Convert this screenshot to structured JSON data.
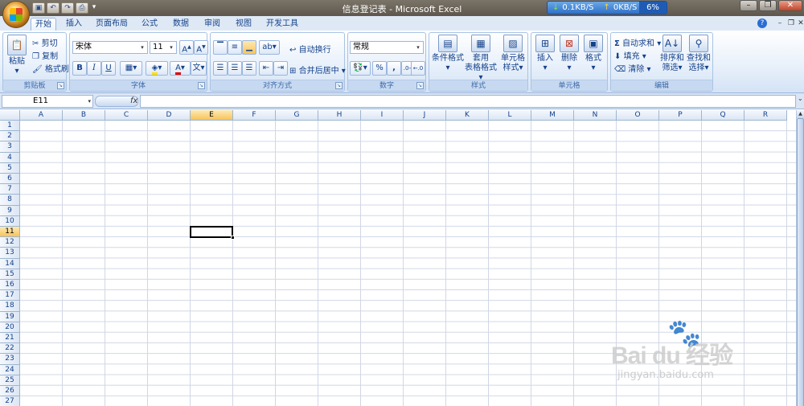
{
  "window": {
    "title": "信息登记表 - Microsoft Excel",
    "net_down": "0.1KB/S",
    "net_up": "0KB/S",
    "net_pct": "6%"
  },
  "tabs": [
    "开始",
    "插入",
    "页面布局",
    "公式",
    "数据",
    "审阅",
    "视图",
    "开发工具"
  ],
  "ribbon": {
    "clipboard": {
      "label": "剪贴板",
      "paste": "粘贴",
      "cut": "剪切",
      "copy": "复制",
      "format_painter": "格式刷"
    },
    "font": {
      "label": "字体",
      "name": "宋体",
      "size": "11",
      "bold": "B",
      "italic": "I",
      "underline": "U",
      "font_color_label": "A"
    },
    "alignment": {
      "label": "对齐方式",
      "wrap": "自动换行",
      "merge": "合并后居中"
    },
    "number": {
      "label": "数字",
      "format": "常规",
      "percent": "%",
      "comma": ","
    },
    "styles": {
      "label": "样式",
      "conditional": "条件格式",
      "table_format_1": "套用",
      "table_format_2": "表格格式",
      "cell_styles_1": "单元格",
      "cell_styles_2": "样式"
    },
    "cells": {
      "label": "单元格",
      "insert": "插入",
      "delete": "删除",
      "format": "格式"
    },
    "editing": {
      "label": "编辑",
      "autosum": "自动求和",
      "fill": "填充",
      "clear": "清除",
      "sort_1": "排序和",
      "sort_2": "筛选",
      "find_1": "查找和",
      "find_2": "选择"
    }
  },
  "formula_bar": {
    "name_box": "E11",
    "fx": "fx"
  },
  "columns": [
    "A",
    "B",
    "C",
    "D",
    "E",
    "F",
    "G",
    "H",
    "I",
    "J",
    "K",
    "L",
    "M",
    "N",
    "O",
    "P",
    "Q",
    "R"
  ],
  "rows": [
    "1",
    "2",
    "3",
    "4",
    "5",
    "6",
    "7",
    "8",
    "9",
    "10",
    "11",
    "12",
    "13",
    "14",
    "15",
    "16",
    "17",
    "18",
    "19",
    "20",
    "21",
    "22",
    "23",
    "24",
    "25",
    "26",
    "27"
  ],
  "selected": {
    "column": "E",
    "row": "11"
  },
  "watermark": {
    "brand": "Bai du 经验",
    "url": "jingyan.baidu.com"
  }
}
